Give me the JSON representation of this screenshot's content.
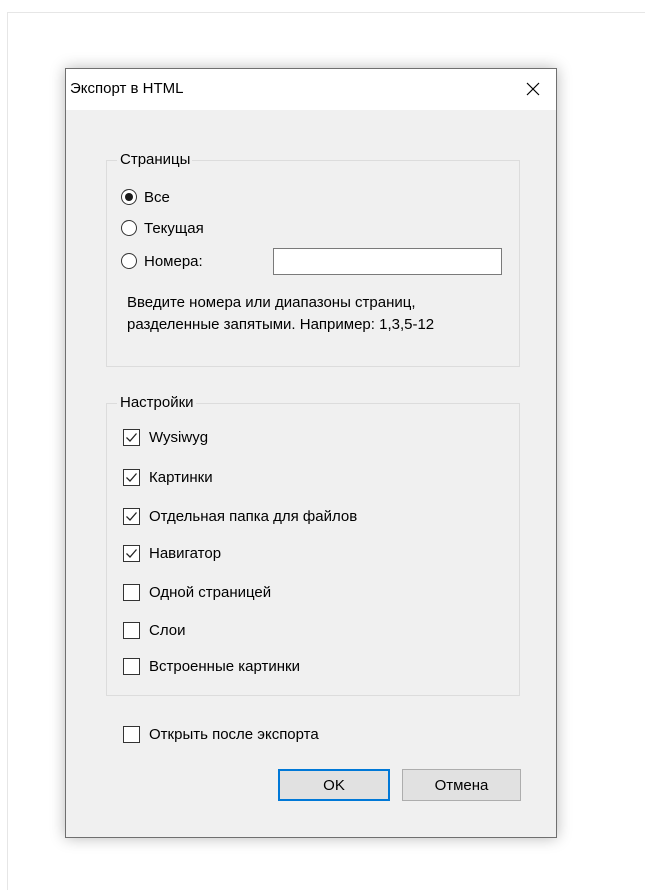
{
  "dialog": {
    "title": "Экспорт в HTML"
  },
  "pages_group": {
    "legend": "Страницы",
    "options": [
      {
        "label": "Все",
        "checked": true
      },
      {
        "label": "Текущая",
        "checked": false
      },
      {
        "label": "Номера:",
        "checked": false
      }
    ],
    "numbers_input_value": "",
    "hint_line1": "Введите номера или диапазоны страниц,",
    "hint_line2": "разделенные запятыми. Например: 1,3,5-12"
  },
  "settings_group": {
    "legend": "Настройки",
    "items": [
      {
        "label": "Wysiwyg",
        "checked": true
      },
      {
        "label": "Картинки",
        "checked": true
      },
      {
        "label": "Отдельная папка для файлов",
        "checked": true
      },
      {
        "label": "Навигатор",
        "checked": true
      },
      {
        "label": "Одной страницей",
        "checked": false
      },
      {
        "label": "Слои",
        "checked": false
      },
      {
        "label": "Встроенные картинки",
        "checked": false
      }
    ]
  },
  "open_after_export": {
    "label": "Открыть после экспорта",
    "checked": false
  },
  "buttons": {
    "ok": "OK",
    "cancel": "Отмена"
  },
  "colors": {
    "dialog_bg": "#f0f0f0",
    "focus_border": "#0078d7"
  },
  "icons": {
    "close": "close-icon",
    "check": "checkmark-icon"
  }
}
